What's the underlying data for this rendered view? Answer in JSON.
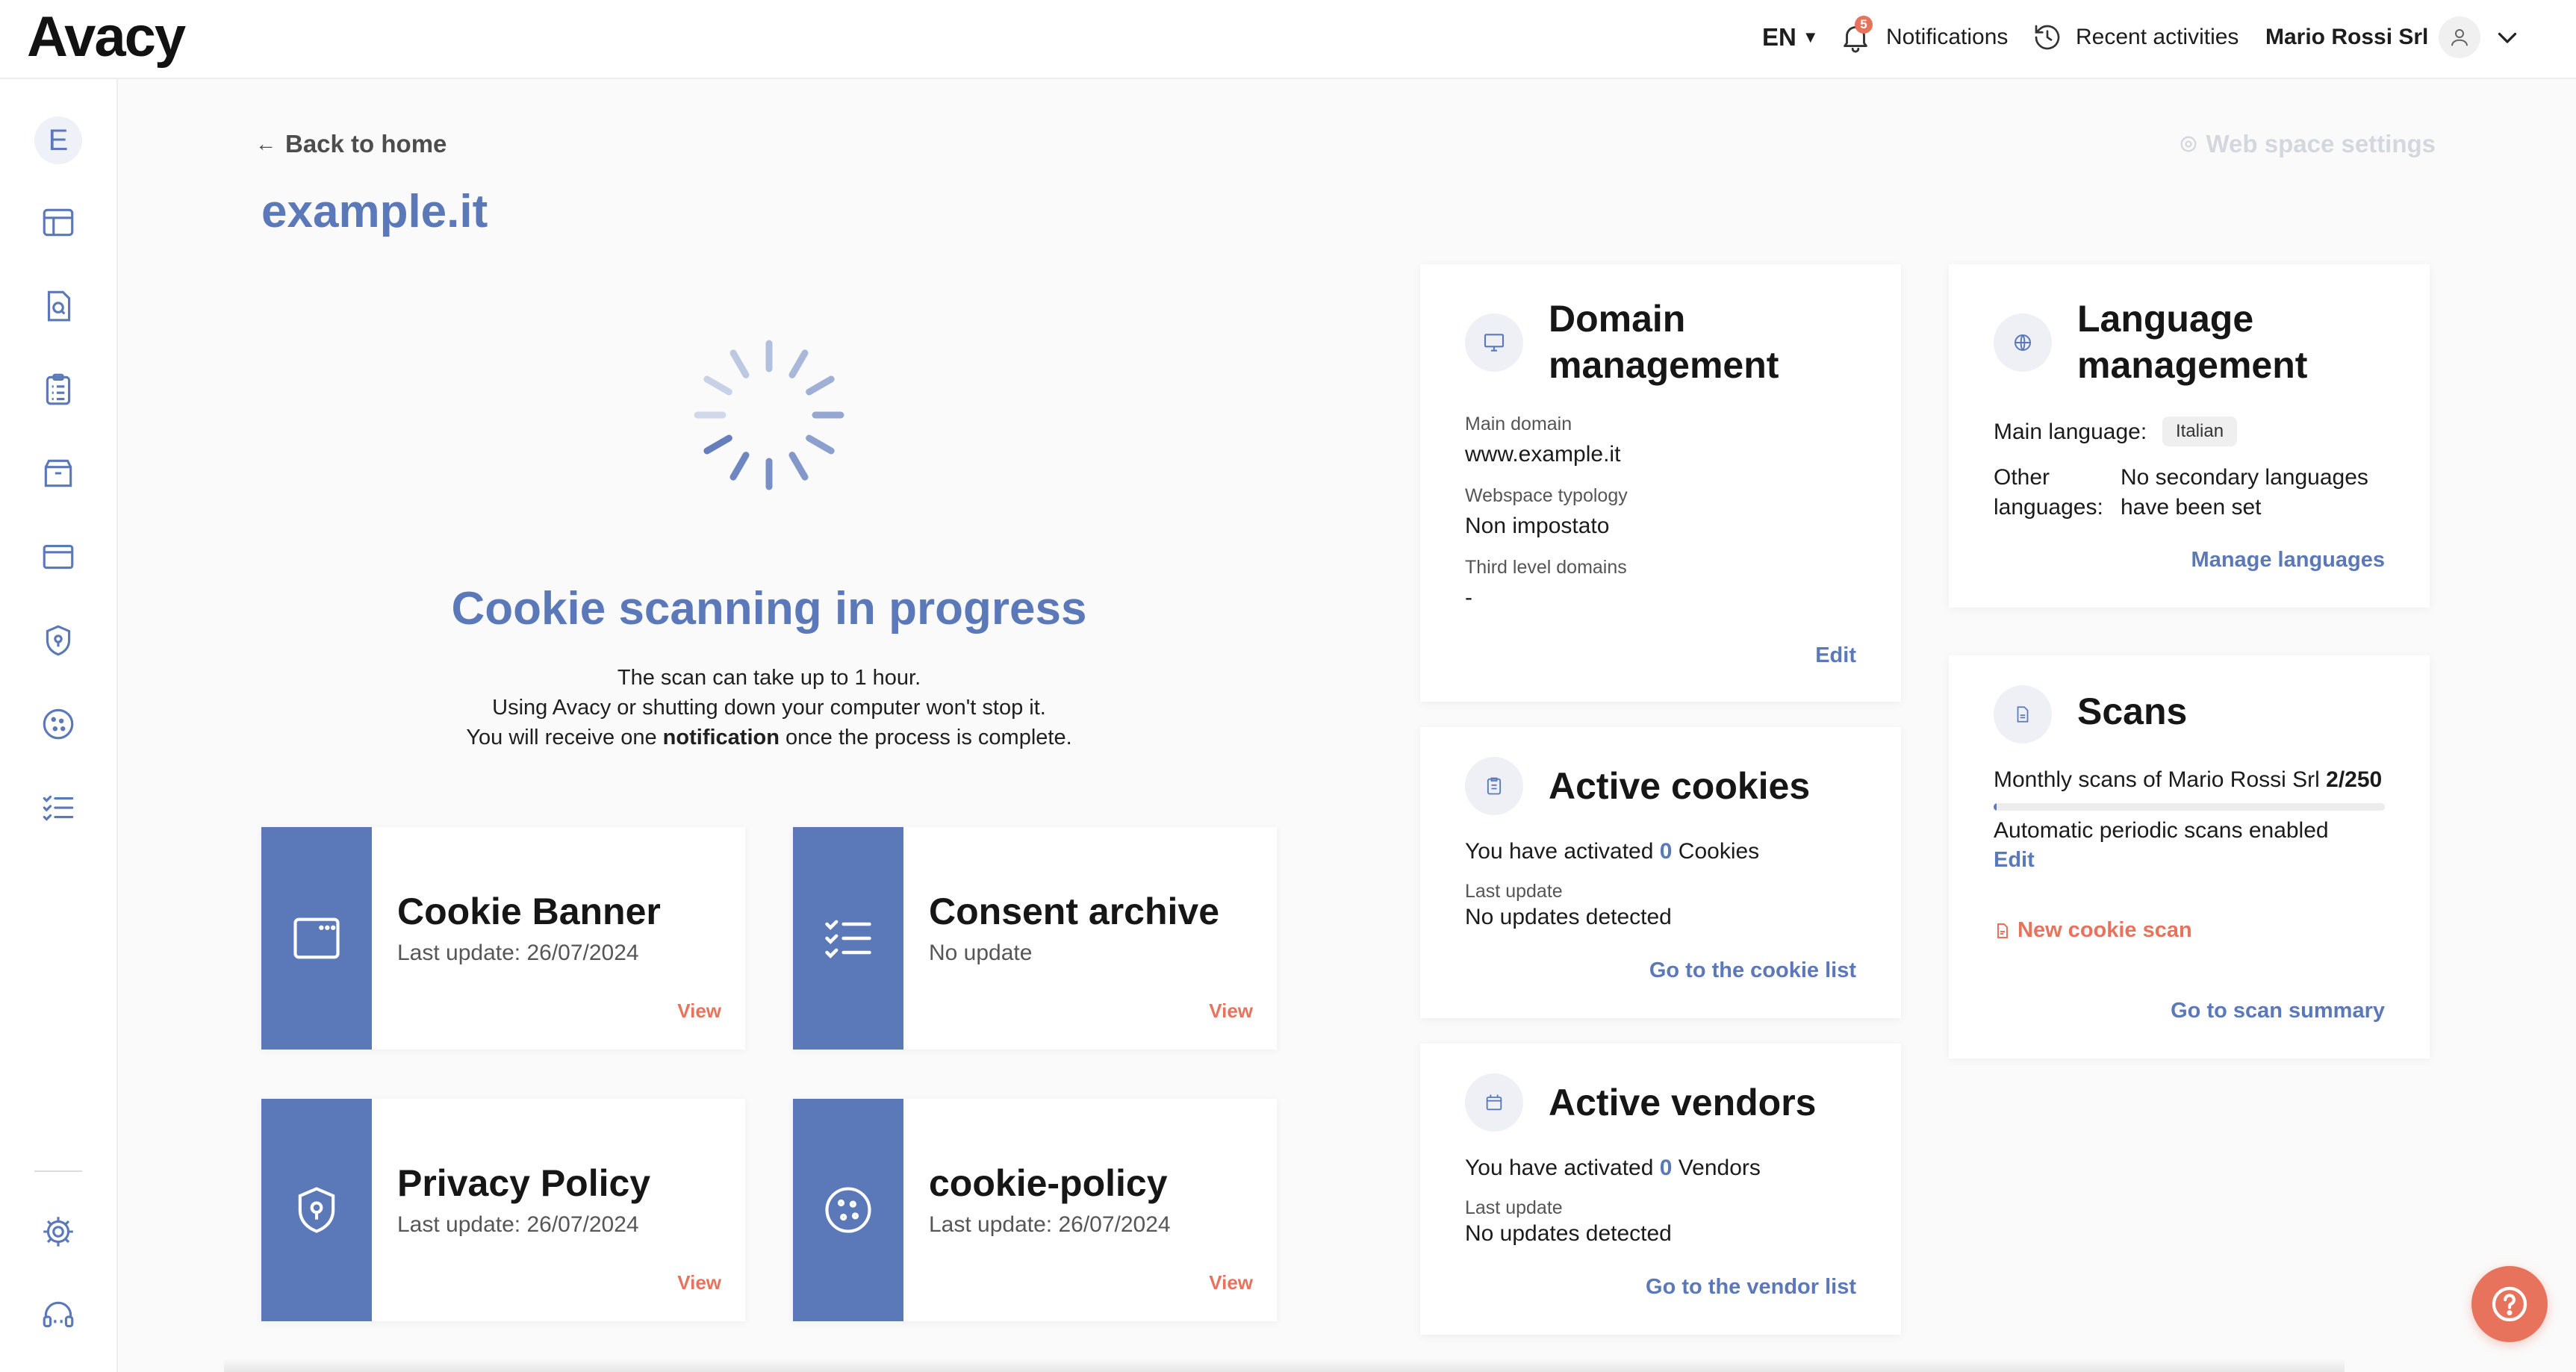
{
  "app": {
    "logo": "Avacy"
  },
  "topbar": {
    "language": "EN",
    "notifications_count": "5",
    "notifications_label": "Notifications",
    "recent_label": "Recent activities",
    "user_name": "Mario Rossi Srl"
  },
  "sidebar": {
    "workspace_initial": "E",
    "items": [
      {
        "icon": "dashboard-icon"
      },
      {
        "icon": "document-search-icon"
      },
      {
        "icon": "clipboard-list-icon"
      },
      {
        "icon": "box-icon"
      },
      {
        "icon": "browser-window-icon"
      },
      {
        "icon": "shield-icon"
      },
      {
        "icon": "cookie-icon"
      },
      {
        "icon": "checklist-icon"
      },
      {
        "icon": "gear-icon"
      },
      {
        "icon": "support-headset-icon"
      }
    ]
  },
  "main": {
    "back_label": "Back to home",
    "settings_label": "Web space settings",
    "title": "example.it",
    "scan": {
      "title": "Cookie scanning in progress",
      "line1": "The scan can take up to 1 hour.",
      "line2": "Using Avacy or shutting down your computer won't stop it.",
      "line3_before": "You will receive one",
      "line3_bold": "notification",
      "line3_after": "once the process is complete."
    },
    "doc_cards": [
      {
        "title": "Cookie Banner",
        "subtitle": "Last update: 26/07/2024",
        "action": "View",
        "icon": "browser-window-icon"
      },
      {
        "title": "Consent archive",
        "subtitle": "No update",
        "action": "View",
        "icon": "checklist-icon"
      },
      {
        "title": "Privacy Policy",
        "subtitle": "Last update: 26/07/2024",
        "action": "View",
        "icon": "shield-icon"
      },
      {
        "title": "cookie-policy",
        "subtitle": "Last update: 26/07/2024",
        "action": "View",
        "icon": "cookie-icon"
      }
    ]
  },
  "domain": {
    "title": "Domain management",
    "main_domain_label": "Main domain",
    "main_domain": "www.example.it",
    "typology_label": "Webspace typology",
    "typology": "Non impostato",
    "third_level_label": "Third level domains",
    "third_level": "-",
    "edit": "Edit"
  },
  "cookies": {
    "title": "Active cookies",
    "activated_before": "You have activated",
    "count": "0",
    "activated_after": "Cookies",
    "last_update_label": "Last update",
    "last_update": "No updates detected",
    "link": "Go to the cookie list"
  },
  "vendors": {
    "title": "Active vendors",
    "activated_before": "You have activated",
    "count": "0",
    "activated_after": "Vendors",
    "last_update_label": "Last update",
    "last_update": "No updates detected",
    "link": "Go to the vendor list"
  },
  "language": {
    "title": "Language management",
    "main_label": "Main language:",
    "main_value": "Italian",
    "other_label": "Other languages:",
    "other_value": "No secondary languages have been set",
    "link": "Manage languages"
  },
  "scans": {
    "title": "Scans",
    "monthly_label": "Monthly scans of Mario Rossi Srl",
    "monthly_value": "2/250",
    "progress_fraction": 0.008,
    "periodic_label": "Automatic periodic scans enabled",
    "edit": "Edit",
    "new_scan": "New cookie scan",
    "summary_link": "Go to scan summary"
  },
  "colors": {
    "brand": "#5b78b9",
    "accent": "#e8735d"
  }
}
